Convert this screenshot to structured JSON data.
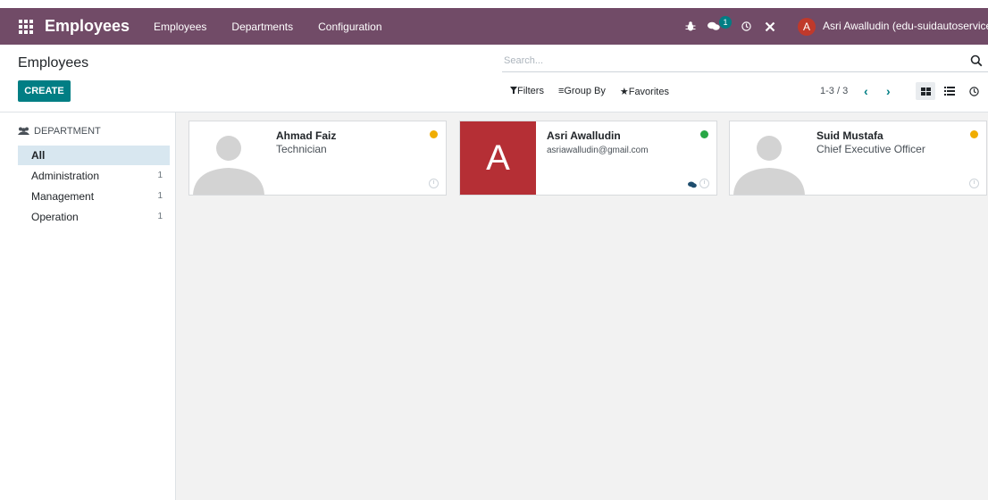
{
  "navbar": {
    "app_name": "Employees",
    "menu": [
      "Employees",
      "Departments",
      "Configuration"
    ],
    "message_count": "1",
    "user_initial": "A",
    "user_name": "Asri Awalludin (edu-suidautoservice)",
    "bg_color": "#714b67"
  },
  "control_panel": {
    "breadcrumb": "Employees",
    "create_label": "CREATE",
    "search_placeholder": "Search...",
    "filters_label": "Filters",
    "group_by_label": "Group By",
    "favorites_label": "Favorites",
    "pager": "1-3 / 3",
    "accent_color": "#017e84"
  },
  "sidebar": {
    "header": "DEPARTMENT",
    "items": [
      {
        "label": "All",
        "count": ""
      },
      {
        "label": "Administration",
        "count": "1"
      },
      {
        "label": "Management",
        "count": "1"
      },
      {
        "label": "Operation",
        "count": "1"
      }
    ]
  },
  "employees": [
    {
      "name": "Ahmad Faiz",
      "subtitle": "Technician",
      "status_color": "#f0ad00",
      "avatar": "placeholder"
    },
    {
      "name": "Asri Awalludin",
      "subtitle": "asriawalludin@gmail.com",
      "status_color": "#28a745",
      "avatar": "A"
    },
    {
      "name": "Suid Mustafa",
      "subtitle": "Chief Executive Officer",
      "status_color": "#f0ad00",
      "avatar": "placeholder"
    }
  ]
}
